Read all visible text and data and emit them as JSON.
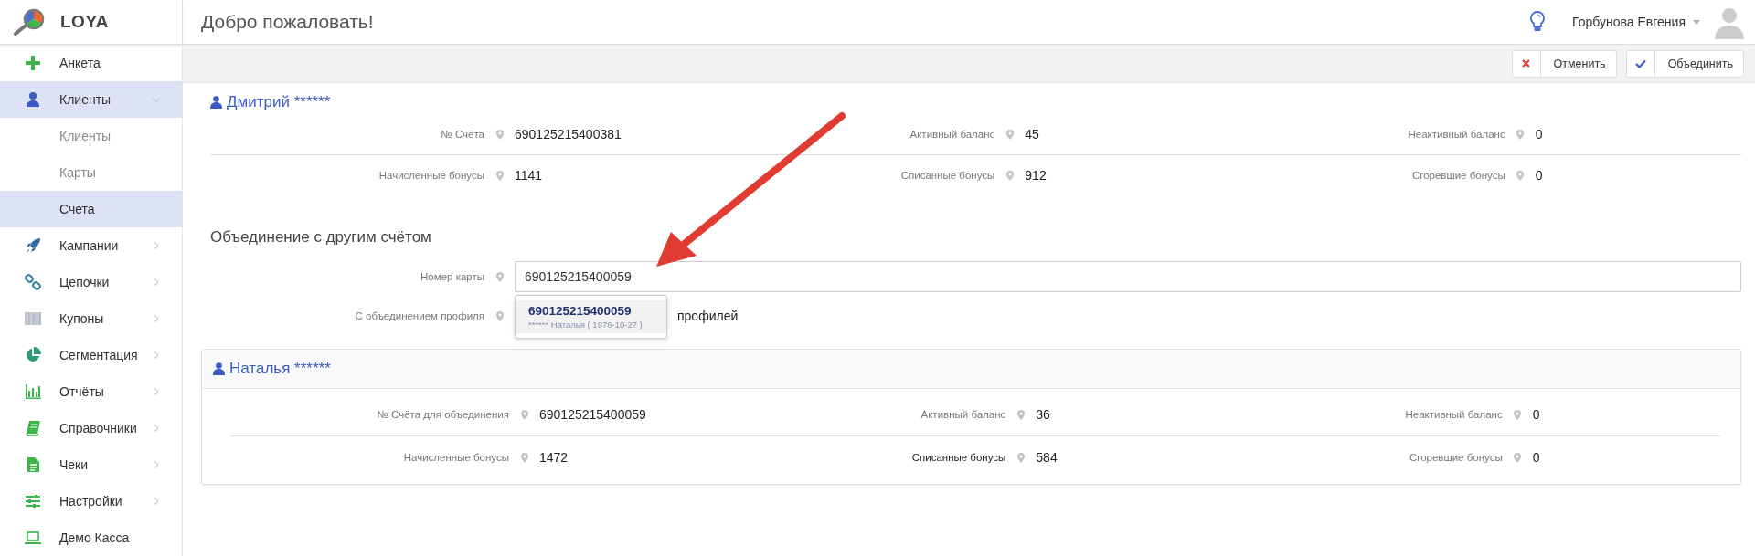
{
  "logo": {
    "text": "LOYA"
  },
  "header": {
    "title": "Добро пожаловать!",
    "user": "Горбунова Евгения"
  },
  "sidebar": {
    "items": [
      {
        "label": "Анкета",
        "selected": false
      },
      {
        "label": "Клиенты",
        "selected": true,
        "expanded": true,
        "children": [
          {
            "label": "Клиенты",
            "selected": false
          },
          {
            "label": "Карты",
            "selected": false
          },
          {
            "label": "Счета",
            "selected": true
          }
        ]
      },
      {
        "label": "Кампании",
        "selected": false,
        "expanded": false
      },
      {
        "label": "Цепочки",
        "selected": false,
        "expanded": false
      },
      {
        "label": "Купоны",
        "selected": false,
        "expanded": false
      },
      {
        "label": "Сегментация",
        "selected": false,
        "expanded": false
      },
      {
        "label": "Отчёты",
        "selected": false,
        "expanded": false
      },
      {
        "label": "Справочники",
        "selected": false,
        "expanded": false
      },
      {
        "label": "Чеки",
        "selected": false,
        "expanded": false
      },
      {
        "label": "Настройки",
        "selected": false,
        "expanded": false
      },
      {
        "label": "Демо Касса",
        "selected": false
      }
    ]
  },
  "toolbar": {
    "buttons": [
      {
        "label": "Отменить",
        "kind": "cancel"
      },
      {
        "label": "Объединить",
        "kind": "confirm"
      }
    ]
  },
  "account": {
    "name": "Дмитрий ******",
    "fields": [
      {
        "label": "№ Счёта",
        "value": "690125215400381",
        "emphasized": false
      },
      {
        "label": "Активный баланс",
        "value": "45",
        "emphasized": false
      },
      {
        "label": "Неактивный баланс",
        "value": "0",
        "emphasized": false
      },
      {
        "label": "Начисленные бонусы",
        "value": "1141",
        "emphasized": false
      },
      {
        "label": "Списанные бонусы",
        "value": "912",
        "emphasized": false
      },
      {
        "label": "Сгоревшие бонусы",
        "value": "0",
        "emphasized": false
      }
    ]
  },
  "merge": {
    "title": "Объединение с другим счётом",
    "card_number": {
      "label": "Номер карты",
      "value": "690125215400059"
    },
    "profile": {
      "label": "С объединением профиля",
      "checkbox_text": "профилей"
    },
    "suggestions": [
      {
        "number": "690125215400059",
        "detail": "****** Наталья ( 1976-10-27 )",
        "selected": true
      }
    ]
  },
  "target_account": {
    "name": "Наталья ******",
    "fields": [
      {
        "label": "№ Счёта для объединения",
        "value": "690125215400059",
        "emphasized": false
      },
      {
        "label": "Активный баланс",
        "value": "36",
        "emphasized": false
      },
      {
        "label": "Неактивный баланс",
        "value": "0",
        "emphasized": false
      },
      {
        "label": "Начисленные бонусы",
        "value": "1472",
        "emphasized": false
      },
      {
        "label": "Списанные бонусы",
        "value": "584",
        "emphasized": true
      },
      {
        "label": "Сгоревшие бонусы",
        "value": "0",
        "emphasized": false
      }
    ]
  }
}
